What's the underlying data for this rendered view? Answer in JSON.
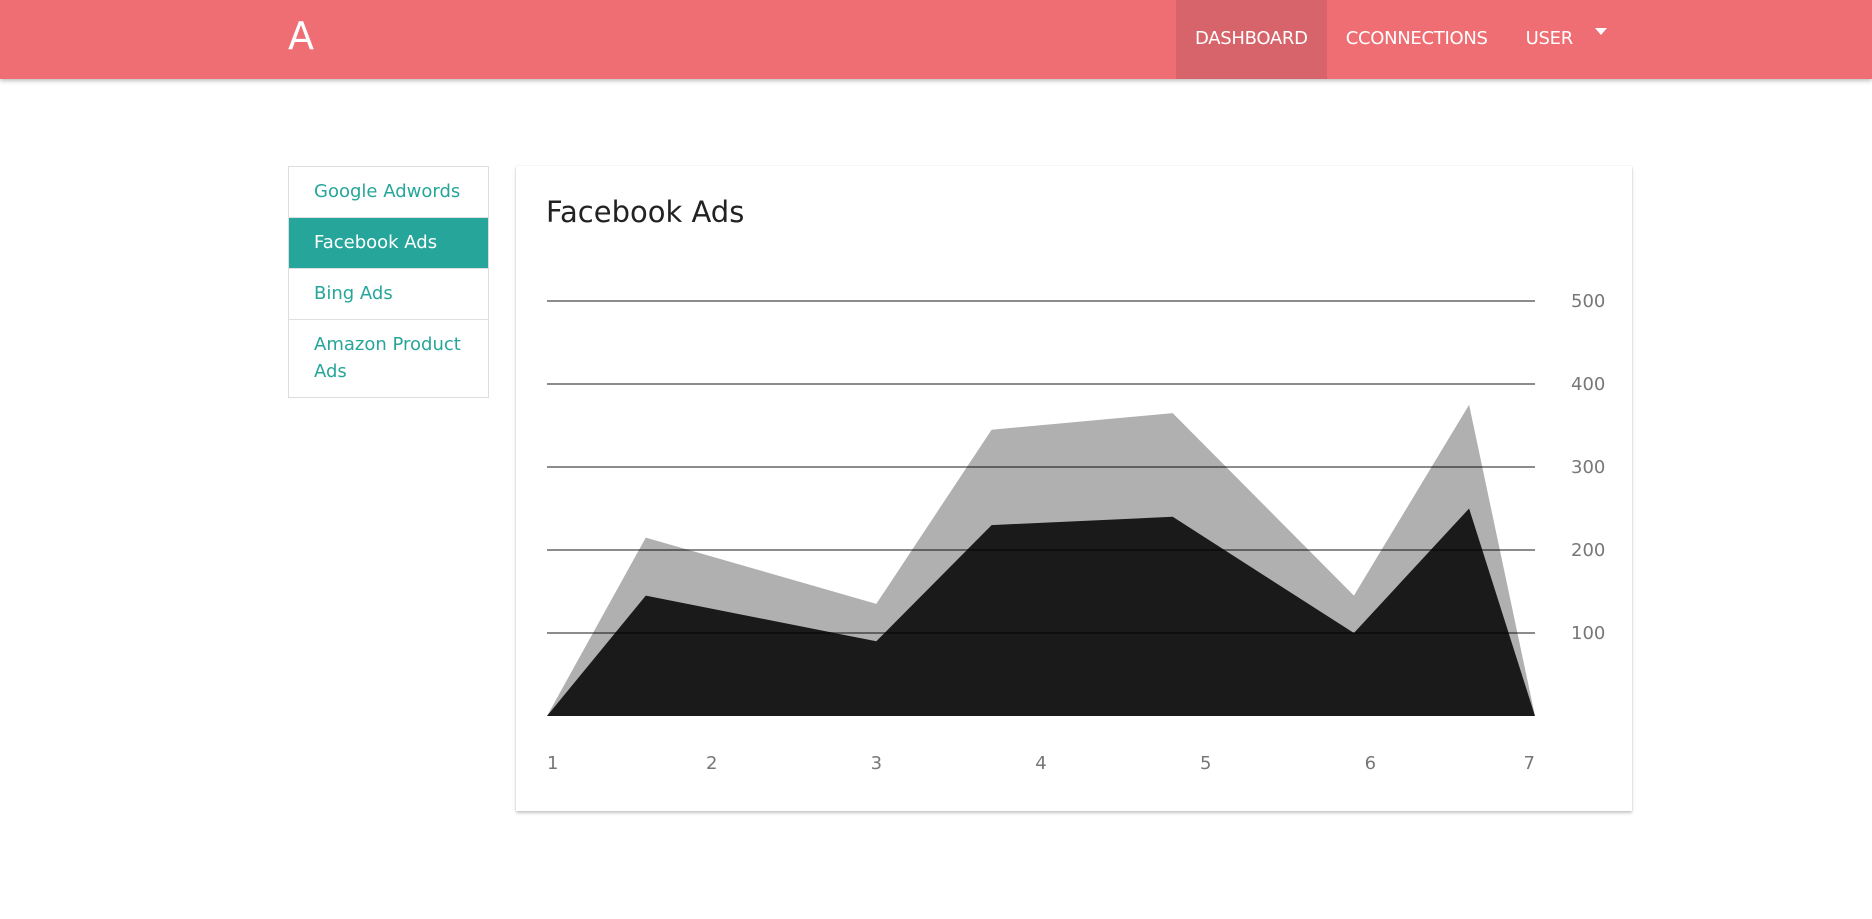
{
  "navbar": {
    "brand": "A",
    "links": [
      {
        "label": "DASHBOARD",
        "active": true
      },
      {
        "label": "CCONNECTIONS",
        "active": false
      },
      {
        "label": "USER",
        "active": false
      }
    ],
    "color": "#ef6e73"
  },
  "sidebar": {
    "items": [
      {
        "label": "Google Adwords",
        "active": false
      },
      {
        "label": "Facebook Ads",
        "active": true
      },
      {
        "label": "Bing Ads",
        "active": false
      },
      {
        "label": "Amazon Product Ads",
        "active": false
      }
    ],
    "accent": "#26a69a"
  },
  "card": {
    "title": "Facebook Ads"
  },
  "chart_data": {
    "type": "area",
    "x": [
      1,
      1.6,
      3,
      3.7,
      4.8,
      5.9,
      6.6,
      7
    ],
    "x_ticks": [
      "1",
      "2",
      "3",
      "4",
      "5",
      "6",
      "7"
    ],
    "y_ticks": [
      "100",
      "200",
      "300",
      "400",
      "500"
    ],
    "ylim": [
      0,
      500
    ],
    "grid": true,
    "series": [
      {
        "color": "#b0b0b0",
        "values": [
          0,
          215,
          135,
          345,
          365,
          145,
          375,
          0
        ]
      },
      {
        "color": "#1a1a1a",
        "values": [
          0,
          145,
          90,
          230,
          240,
          100,
          250,
          0
        ]
      }
    ]
  }
}
